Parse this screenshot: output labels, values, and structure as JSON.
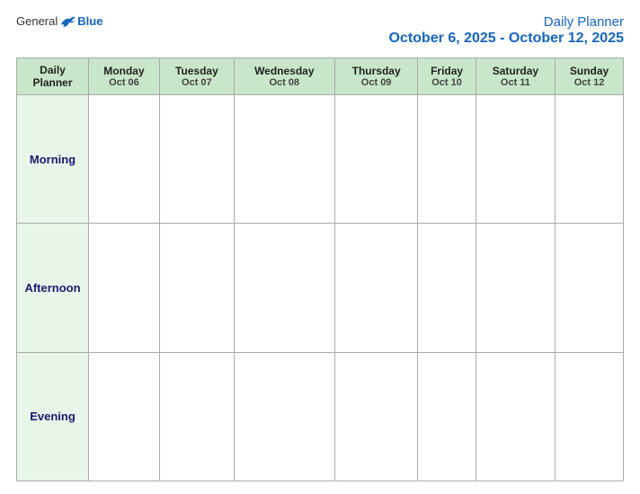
{
  "header": {
    "logo": {
      "general": "General",
      "blue": "Blue"
    },
    "title": "Daily Planner",
    "date_range": "October 6, 2025 - October 12, 2025"
  },
  "table": {
    "label_header": {
      "line1": "Daily",
      "line2": "Planner"
    },
    "days": [
      {
        "name": "Monday",
        "date": "Oct 06"
      },
      {
        "name": "Tuesday",
        "date": "Oct 07"
      },
      {
        "name": "Wednesday",
        "date": "Oct 08"
      },
      {
        "name": "Thursday",
        "date": "Oct 09"
      },
      {
        "name": "Friday",
        "date": "Oct 10"
      },
      {
        "name": "Saturday",
        "date": "Oct 11"
      },
      {
        "name": "Sunday",
        "date": "Oct 12"
      }
    ],
    "time_slots": [
      "Morning",
      "Afternoon",
      "Evening"
    ]
  }
}
